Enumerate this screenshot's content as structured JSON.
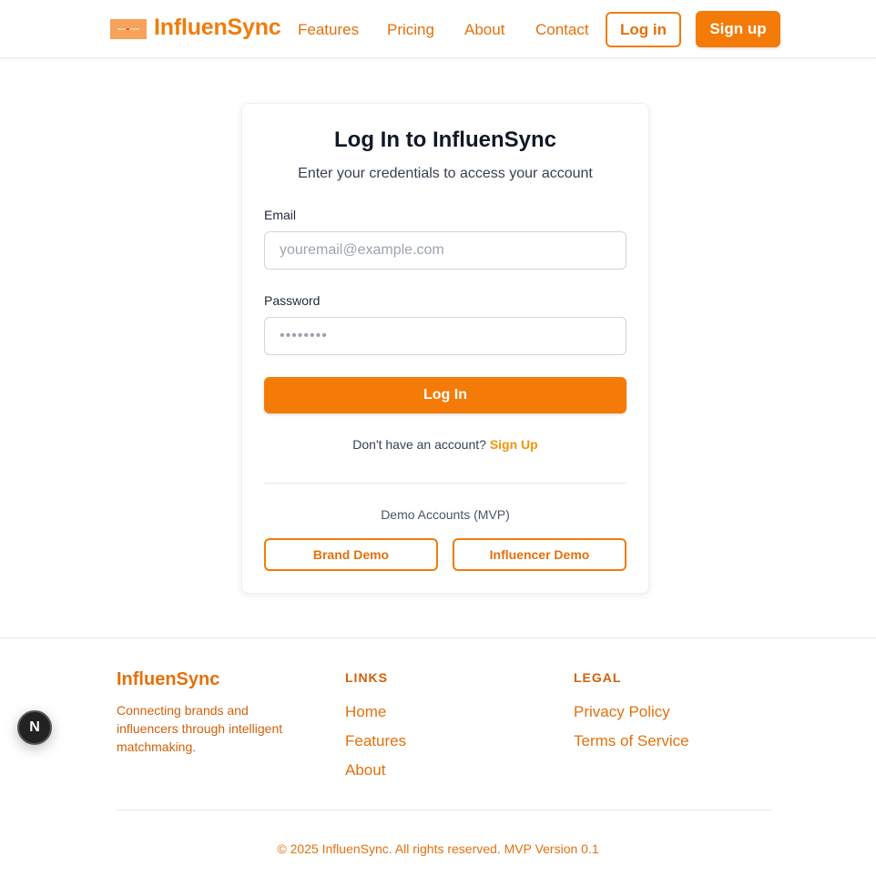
{
  "header": {
    "brand": "InfluenSync",
    "logo_icon": "brand-logo-icon",
    "nav": [
      "Features",
      "Pricing",
      "About",
      "Contact"
    ],
    "login_label": "Log in",
    "signup_label": "Sign up"
  },
  "login": {
    "title": "Log In to InfluenSync",
    "subtitle": "Enter your credentials to access your account",
    "email_label": "Email",
    "email_placeholder": "youremail@example.com",
    "password_label": "Password",
    "password_placeholder": "••••••••",
    "submit_label": "Log In",
    "no_account_text": "Don't have an account?",
    "signup_link": "Sign Up",
    "demo_label": "Demo Accounts (MVP)",
    "demo_buttons": [
      "Brand Demo",
      "Influencer Demo"
    ]
  },
  "footer": {
    "brand": "InfluenSync",
    "description": "Connecting brands and influencers through intelligent matchmaking.",
    "links_heading": "LINKS",
    "links": [
      "Home",
      "Features",
      "About"
    ],
    "legal_heading": "LEGAL",
    "legal": [
      "Privacy Policy",
      "Terms of Service"
    ],
    "copyright": "© 2025 InfluenSync. All rights reserved. MVP Version 0.1"
  },
  "dev_badge": {
    "letter": "N",
    "icon": "nextjs-icon"
  },
  "colors": {
    "accent": "#f47b08",
    "accent_text": "#e4700c",
    "link": "#f4930c"
  }
}
